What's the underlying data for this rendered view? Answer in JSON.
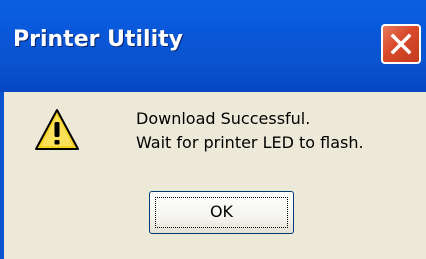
{
  "window": {
    "title": "Printer Utility"
  },
  "message": {
    "line1": "Download Successful.",
    "line2": "Wait for printer LED to flash."
  },
  "buttons": {
    "ok_label": "OK"
  },
  "icons": {
    "message_icon": "warning-icon",
    "close_icon": "close-icon"
  },
  "colors": {
    "titlebar": "#0a52cf",
    "close_button": "#d8492a",
    "dialog_background": "#ece9d8",
    "warning_yellow": "#f7d31c"
  }
}
